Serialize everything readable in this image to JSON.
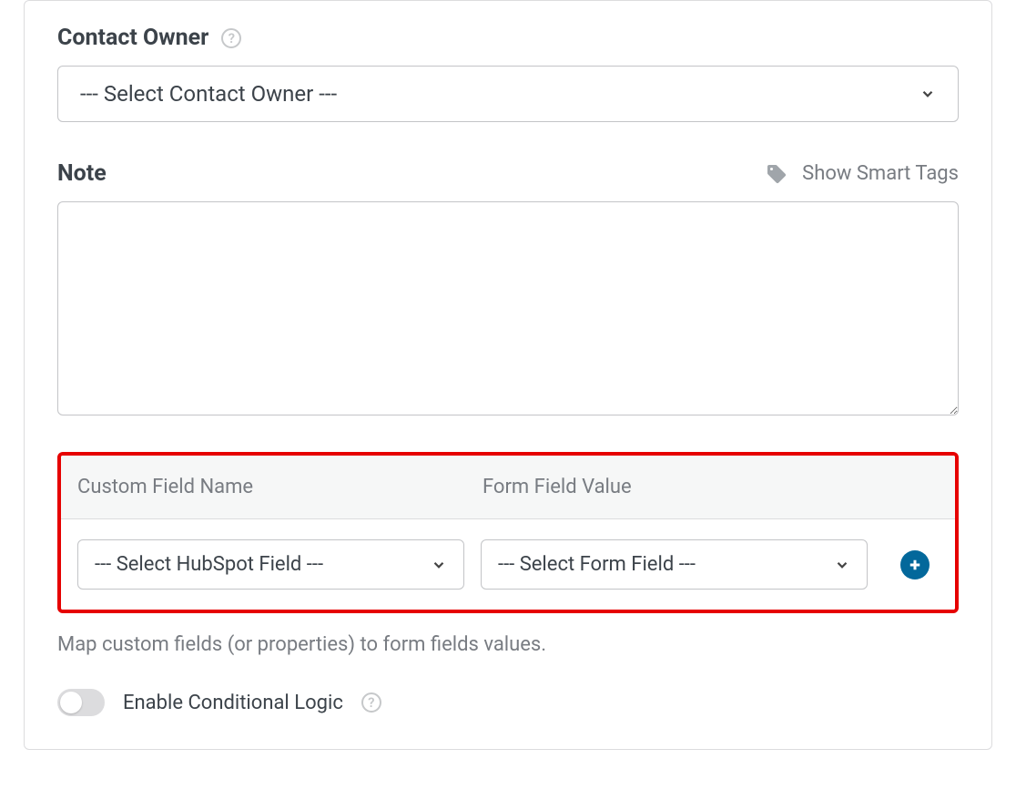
{
  "contactOwner": {
    "label": "Contact Owner",
    "placeholder": "--- Select Contact Owner ---"
  },
  "note": {
    "label": "Note",
    "smartTagsLabel": "Show Smart Tags",
    "value": ""
  },
  "mapping": {
    "header": {
      "col1": "Custom Field Name",
      "col2": "Form Field Value"
    },
    "hubspotSelect": "--- Select HubSpot Field ---",
    "formFieldSelect": "--- Select Form Field ---",
    "helpText": "Map custom fields (or properties) to form fields values."
  },
  "conditional": {
    "label": "Enable Conditional Logic",
    "enabled": false
  }
}
